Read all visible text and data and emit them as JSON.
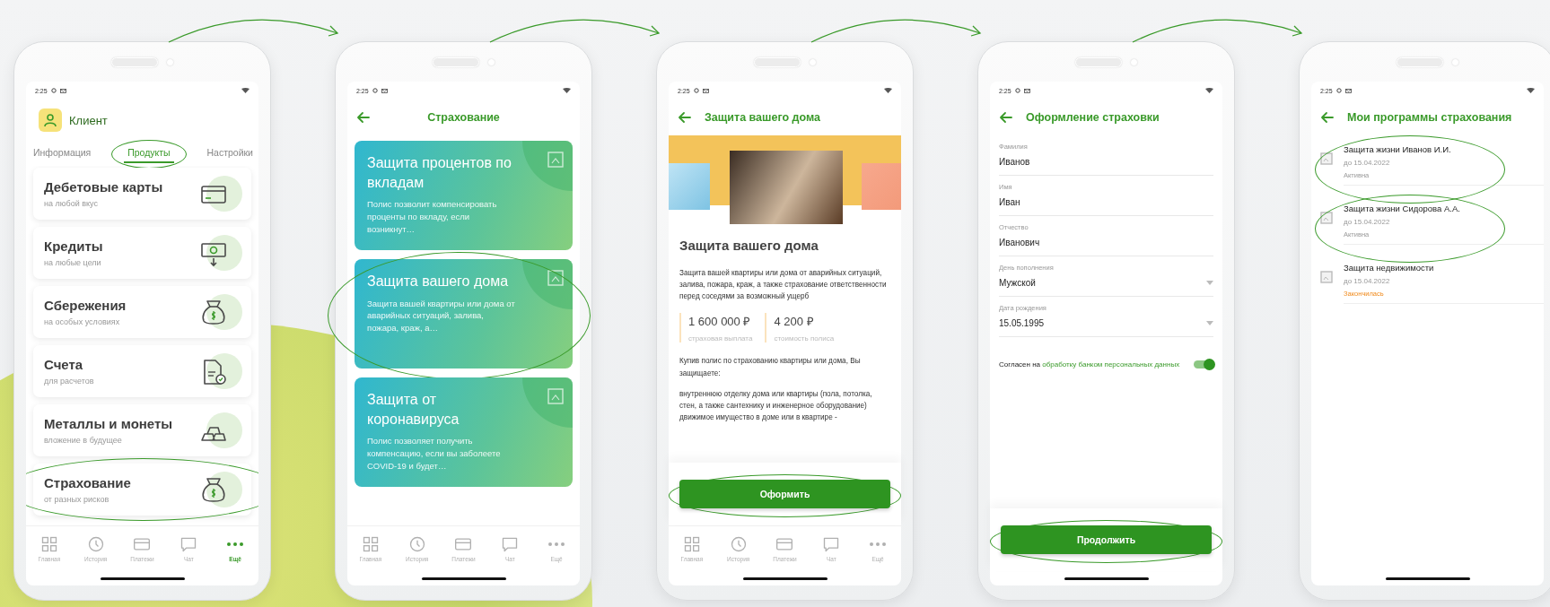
{
  "screens": [
    {
      "kind": "profile",
      "status_time": "2:25",
      "user_name": "Клиент",
      "tabs": [
        {
          "label": "Информация",
          "selected": false,
          "highlighted": false
        },
        {
          "label": "Продукты",
          "selected": true,
          "highlighted": true
        },
        {
          "label": "Настройки",
          "selected": false,
          "highlighted": false
        }
      ],
      "products": [
        {
          "title": "Дебетовые карты",
          "subtitle": "на любой вкус",
          "highlighted": false
        },
        {
          "title": "Кредиты",
          "subtitle": "на любые цели",
          "highlighted": false
        },
        {
          "title": "Сбережения",
          "subtitle": "на особых условиях",
          "highlighted": false
        },
        {
          "title": "Счета",
          "subtitle": "для расчетов",
          "highlighted": false
        },
        {
          "title": "Металлы и монеты",
          "subtitle": "вложение в будущее",
          "highlighted": false
        },
        {
          "title": "Страхование",
          "subtitle": "от разных рисков",
          "highlighted": true
        }
      ],
      "nav": [
        {
          "label": "Главная",
          "selected": false
        },
        {
          "label": "История",
          "selected": false
        },
        {
          "label": "Платежи",
          "selected": false
        },
        {
          "label": "Чат",
          "selected": false
        },
        {
          "label": "Ещё",
          "selected": true
        }
      ]
    },
    {
      "kind": "catalog",
      "status_time": "2:25",
      "title": "Страхование",
      "cards": [
        {
          "title": "Защита процентов по вкладам",
          "description": "Полис позволит компенсировать проценты по вкладу, если возникнут…",
          "highlighted": false
        },
        {
          "title": "Защита вашего дома",
          "description": "Защита вашей квартиры или дома от аварийных ситуаций, залива, пожара, краж, а…",
          "highlighted": true
        },
        {
          "title": "Защита от коронавируса",
          "description": "Полис позволяет получить компенсацию, если вы заболеете COVID-19 и будет…",
          "highlighted": false
        }
      ],
      "nav": [
        {
          "label": "Главная",
          "selected": false
        },
        {
          "label": "История",
          "selected": false
        },
        {
          "label": "Платежи",
          "selected": false
        },
        {
          "label": "Чат",
          "selected": false
        },
        {
          "label": "Ещё",
          "selected": false
        }
      ]
    },
    {
      "kind": "detail",
      "status_time": "2:25",
      "title": "Защита вашего дома",
      "heading": "Защита вашего дома",
      "description": "Защита вашей квартиры или дома от аварийных ситуаций, залива, пожара, краж, а также страхование ответственности перед соседями за возможный ущерб",
      "stats": [
        {
          "value": "1 600 000 ₽",
          "label": "страховая выплата"
        },
        {
          "value": "4 200 ₽",
          "label": "стоимость полиса"
        }
      ],
      "intro": "Купив полис по страхованию квартиры или дома, Вы защищаете:",
      "coverage": [
        "внутреннюю отделку дома или квартиры (пола, потолка, стен, а также сантехнику и инженерное оборудование)",
        "движимое имущество в доме или в квартире -"
      ],
      "button": {
        "label": "Оформить",
        "highlighted": true
      },
      "nav": [
        {
          "label": "Главная",
          "selected": false
        },
        {
          "label": "История",
          "selected": false
        },
        {
          "label": "Платежи",
          "selected": false
        },
        {
          "label": "Чат",
          "selected": false
        },
        {
          "label": "Ещё",
          "selected": false
        }
      ]
    },
    {
      "kind": "form",
      "status_time": "2:25",
      "title": "Оформление страховки",
      "fields": [
        {
          "kind": "text",
          "label": "Фамилия",
          "value": "Иванов"
        },
        {
          "kind": "text",
          "label": "Имя",
          "value": "Иван"
        },
        {
          "kind": "text",
          "label": "Отчество",
          "value": "Иванович"
        },
        {
          "kind": "select",
          "label": "День пополнения",
          "value": "Мужской"
        },
        {
          "kind": "select",
          "label": "Дата рождения",
          "value": "15.05.1995"
        }
      ],
      "consent": {
        "text": "Согласен на",
        "link": "обработку банком персональных данных",
        "on": true
      },
      "button": {
        "label": "Продолжить",
        "highlighted": true
      }
    },
    {
      "kind": "programs",
      "status_time": "2:25",
      "title": "Мои программы страхования",
      "programs": [
        {
          "title": "Защита жизни Иванов И.И.",
          "date": "до 15.04.2022",
          "status": "Активна",
          "expired": false,
          "highlighted": true
        },
        {
          "title": "Защита жизни Сидорова А.А.",
          "date": "до 15.04.2022",
          "status": "Активна",
          "expired": false,
          "highlighted": true
        },
        {
          "title": "Защита недвижимости",
          "date": "до 15.04.2022",
          "status": "Закончилась",
          "expired": true,
          "highlighted": false
        }
      ]
    }
  ]
}
